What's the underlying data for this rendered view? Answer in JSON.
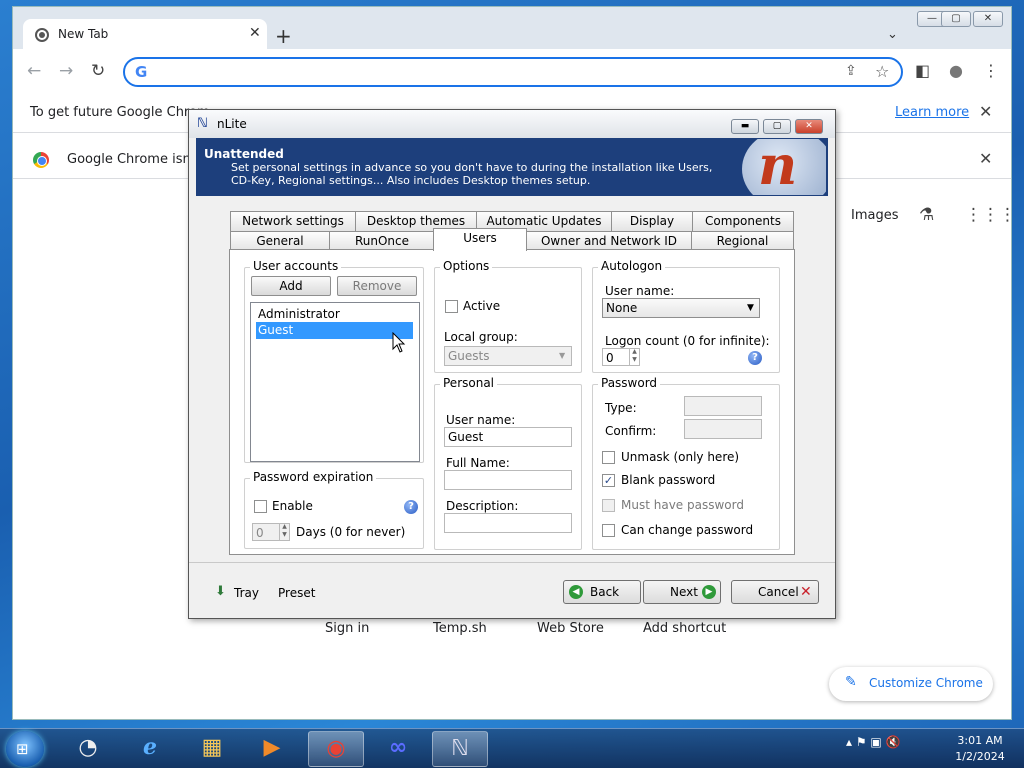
{
  "browser": {
    "tab_title": "New Tab",
    "tab_close": "✕",
    "new_tab": "+",
    "tab_list": "⌄",
    "window_controls": [
      "—",
      "▢",
      "✕"
    ],
    "nav": {
      "back": "←",
      "forward": "→",
      "reload": "↻"
    },
    "omnibox": {
      "logo": "G",
      "value": "",
      "share": "⇪",
      "star": "☆"
    },
    "toolbar_icons": {
      "sidepanel": "◧",
      "profile": "●",
      "menu": "⋮"
    },
    "infobar1": {
      "text": "To get future Google Chrom",
      "link": "Learn more",
      "close": "✕"
    },
    "infobar2": {
      "text": "Google Chrome isn't",
      "close": "✕"
    },
    "ntp": {
      "images": "Images",
      "labs": "⚗",
      "apps": "⋮⋮⋮",
      "shortcuts": [
        "Sign in",
        "Temp.sh",
        "Web Store",
        "Add shortcut"
      ],
      "customize": "Customize Chrome",
      "customize_icon": "✎"
    }
  },
  "dialog": {
    "title": "nLite",
    "title_icon": "ℕ",
    "controls": [
      "▬",
      "▢",
      "✕"
    ],
    "header": {
      "title": "Unattended",
      "subtitle": "Set personal settings in advance so you don't have to during the installation like Users, CD-Key, Regional settings... Also includes Desktop themes setup."
    },
    "logo_glyph": "n",
    "tabs_row1": [
      "Network settings",
      "Desktop themes",
      "Automatic Updates",
      "Display",
      "Components"
    ],
    "tabs_row2": [
      "General",
      "RunOnce",
      "Users",
      "Owner and Network ID",
      "Regional"
    ],
    "selected_tab": "Users",
    "user_accounts": {
      "label": "User accounts",
      "add": "Add",
      "remove": "Remove",
      "items": [
        "Administrator",
        "Guest"
      ],
      "selected": "Guest"
    },
    "password_expiration": {
      "label": "Password expiration",
      "enable": "Enable",
      "days_value": "0",
      "days_label": "Days (0 for never)"
    },
    "options": {
      "label": "Options",
      "active": "Active",
      "local_group_label": "Local group:",
      "local_group_value": "Guests"
    },
    "personal": {
      "label": "Personal",
      "user_name_label": "User name:",
      "user_name_value": "Guest",
      "full_name_label": "Full Name:",
      "full_name_value": "",
      "description_label": "Description:",
      "description_value": ""
    },
    "autologon": {
      "label": "Autologon",
      "user_name_label": "User name:",
      "user_name_value": "None",
      "logon_count_label": "Logon count (0 for infinite):",
      "logon_count_value": "0"
    },
    "password": {
      "label": "Password",
      "type_label": "Type:",
      "confirm_label": "Confirm:",
      "unmask": "Unmask (only here)",
      "blank": "Blank password",
      "must_have": "Must have password",
      "can_change": "Can change password",
      "blank_checked": "✓"
    },
    "help_glyph": "?",
    "footer": {
      "tray": "Tray",
      "preset": "Preset",
      "back": "Back",
      "next": "Next",
      "cancel": "Cancel",
      "back_icon": "◀",
      "next_icon": "▶",
      "cancel_icon": "✕",
      "tray_icon": "⬇"
    }
  },
  "taskbar": {
    "start_icon": "⊞",
    "items": [
      {
        "name": "clock-app",
        "glyph": "◔"
      },
      {
        "name": "internet-explorer",
        "glyph": "ℯ"
      },
      {
        "name": "file-explorer",
        "glyph": "▦"
      },
      {
        "name": "media-player",
        "glyph": "▶"
      },
      {
        "name": "chrome",
        "glyph": "◉"
      },
      {
        "name": "infinity-app",
        "glyph": "∞"
      },
      {
        "name": "nlite",
        "glyph": "ℕ"
      }
    ],
    "tray_icons": "▴ ⚑ ▣ 🔇",
    "time": "3:01 AM",
    "date": "1/2/2024"
  }
}
